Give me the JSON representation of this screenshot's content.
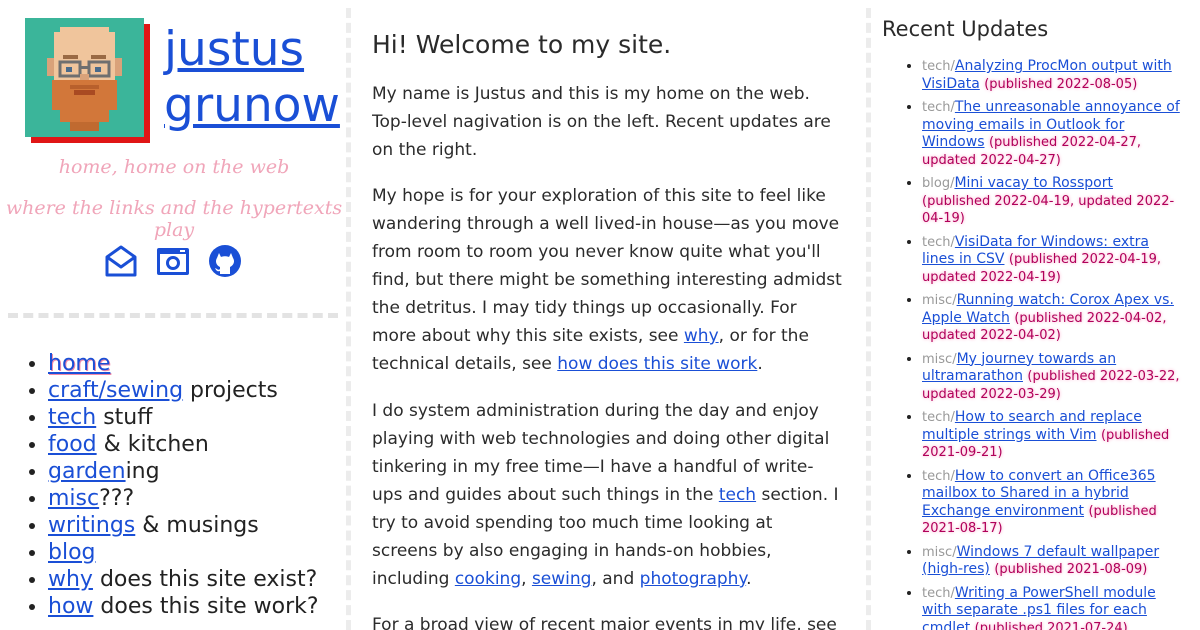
{
  "site": {
    "name_first": "justus",
    "name_last": "grunow",
    "tagline_1": "home, home on the web",
    "tagline_2": "where the links and the hypertexts play"
  },
  "socials": [
    {
      "icon": "envelope-icon"
    },
    {
      "icon": "camera-icon"
    },
    {
      "icon": "github-icon"
    }
  ],
  "nav": [
    {
      "link": "home",
      "suffix": ""
    },
    {
      "link": "craft/sewing",
      "suffix": " projects"
    },
    {
      "link": "tech",
      "suffix": " stuff"
    },
    {
      "link": "food",
      "suffix": " & kitchen"
    },
    {
      "link": "garden",
      "suffix": "ing"
    },
    {
      "link": "misc",
      "suffix": "???"
    },
    {
      "link": "writings",
      "suffix": " & musings"
    },
    {
      "link": "blog",
      "suffix": ""
    },
    {
      "link": "why",
      "suffix": " does this site exist?"
    },
    {
      "link": "how",
      "suffix": " does this site work?"
    }
  ],
  "main": {
    "heading": "Hi! Welcome to my site.",
    "p1": "My name is Justus and this is my home on the web. Top-level nagivation is on the left. Recent updates are on the right.",
    "p2_a": "My hope is for your exploration of this site to feel like wandering through a well lived-in house—as you move from room to room you never know quite what you'll find, but there might be something interesting admidst the detritus. I may tidy things up occasionally. For more about why this site exists, see ",
    "p2_link1": "why",
    "p2_b": ", or for the technical details, see ",
    "p2_link2": "how does this site work",
    "p2_c": ".",
    "p3_a": "I do system administration during the day and enjoy playing with web technologies and doing other digital tinkering in my free time—I have a handful of write-ups and guides about such things in the ",
    "p3_link1": "tech",
    "p3_b": " section. I try to avoid spending too much time looking at screens by also engaging in hands-on hobbies, including ",
    "p3_link2": "cooking",
    "p3_c": ", ",
    "p3_link3": "sewing",
    "p3_d": ", and ",
    "p3_link4": "photography",
    "p3_e": ".",
    "p4": "For a broad view of recent major events in my life, see"
  },
  "updates": {
    "heading": "Recent Updates",
    "items": [
      {
        "cat": "tech/",
        "title": "Analyzing ProcMon output with VisiData",
        "dates": "(published 2022-08-05)"
      },
      {
        "cat": "tech/",
        "title": "The unreasonable annoyance of moving emails in Outlook for Windows",
        "dates": "(published 2022-04-27, updated 2022-04-27)"
      },
      {
        "cat": "blog/",
        "title": "Mini vacay to Rossport",
        "dates": "(published 2022-04-19, updated 2022-04-19)"
      },
      {
        "cat": "tech/",
        "title": "VisiData for Windows: extra lines in CSV",
        "dates": "(published 2022-04-19, updated 2022-04-19)"
      },
      {
        "cat": "misc/",
        "title": "Running watch: Corox Apex vs. Apple Watch",
        "dates": "(published 2022-04-02, updated 2022-04-02)"
      },
      {
        "cat": "misc/",
        "title": "My journey towards an ultramarathon",
        "dates": "(published 2022-03-22, updated 2022-03-29)"
      },
      {
        "cat": "tech/",
        "title": "How to search and replace multiple strings with Vim",
        "dates": "(published 2021-09-21)"
      },
      {
        "cat": "tech/",
        "title": "How to convert an Office365 mailbox to Shared in a hybrid Exchange environment",
        "dates": "(published 2021-08-17)"
      },
      {
        "cat": "misc/",
        "title": "Windows 7 default wallpaper (high-res)",
        "dates": "(published 2021-08-09)"
      },
      {
        "cat": "tech/",
        "title": "Writing a PowerShell module with separate .ps1 files for each cmdlet",
        "dates": "(published 2021-07-24)"
      }
    ]
  }
}
